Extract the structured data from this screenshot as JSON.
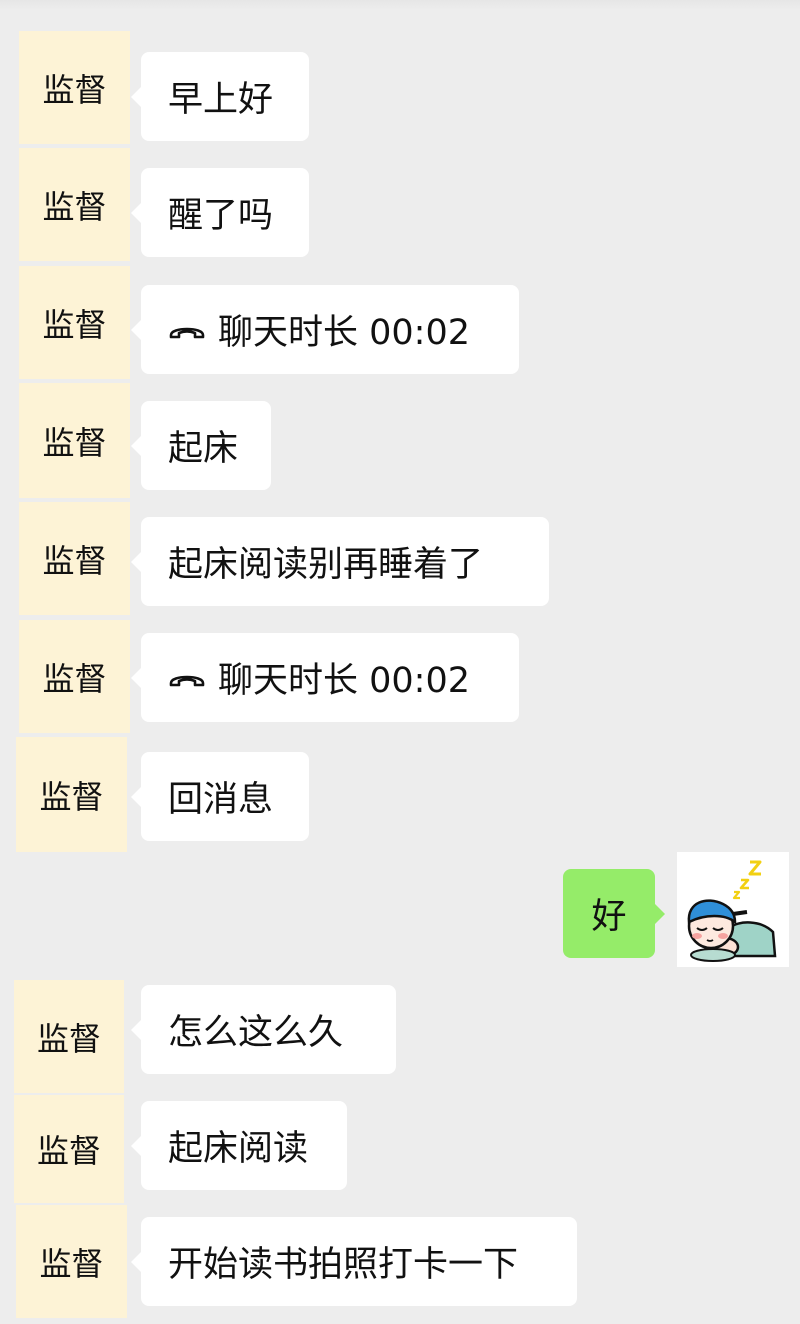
{
  "contact": {
    "avatar_label": "监督"
  },
  "messages": [
    {
      "text": "早上好"
    },
    {
      "text": "醒了吗"
    },
    {
      "text": "聊天时长 00:02",
      "icon": "phone-hangup-icon"
    },
    {
      "text": "起床"
    },
    {
      "text": "起床阅读别再睡着了"
    },
    {
      "text": "聊天时长 00:02",
      "icon": "phone-hangup-icon"
    },
    {
      "text": "回消息"
    },
    {
      "text": "好"
    },
    {
      "text": "怎么这么久"
    },
    {
      "text": "起床阅读"
    },
    {
      "text": "开始读书拍照打卡一下"
    }
  ],
  "sticker": {
    "icon": "sleeping-boy-sticker-icon"
  },
  "colors": {
    "background": "#ededed",
    "incoming_bubble": "#ffffff",
    "outgoing_bubble": "#95ec69",
    "avatar_bg": "#fdf3d6"
  }
}
